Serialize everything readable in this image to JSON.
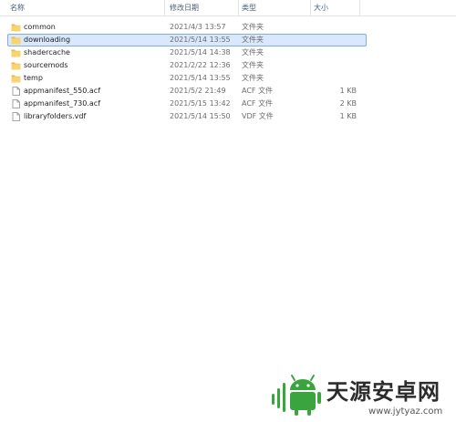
{
  "columns": {
    "name": "名称",
    "date": "修改日期",
    "type": "类型",
    "size": "大小"
  },
  "files": [
    {
      "name": "common",
      "date": "2021/4/3 13:57",
      "type": "文件夹",
      "size": "",
      "icon": "folder-icon",
      "selected": false
    },
    {
      "name": "downloading",
      "date": "2021/5/14 13:55",
      "type": "文件夹",
      "size": "",
      "icon": "folder-icon",
      "selected": true
    },
    {
      "name": "shadercache",
      "date": "2021/5/14 14:38",
      "type": "文件夹",
      "size": "",
      "icon": "folder-icon",
      "selected": false
    },
    {
      "name": "sourcemods",
      "date": "2021/2/22 12:36",
      "type": "文件夹",
      "size": "",
      "icon": "folder-icon",
      "selected": false
    },
    {
      "name": "temp",
      "date": "2021/5/14 13:55",
      "type": "文件夹",
      "size": "",
      "icon": "folder-icon",
      "selected": false
    },
    {
      "name": "appmanifest_550.acf",
      "date": "2021/5/2 21:49",
      "type": "ACF 文件",
      "size": "1 KB",
      "icon": "file-icon",
      "selected": false
    },
    {
      "name": "appmanifest_730.acf",
      "date": "2021/5/15 13:42",
      "type": "ACF 文件",
      "size": "2 KB",
      "icon": "file-icon",
      "selected": false
    },
    {
      "name": "libraryfolders.vdf",
      "date": "2021/5/14 15:50",
      "type": "VDF 文件",
      "size": "1 KB",
      "icon": "file-icon",
      "selected": false
    }
  ],
  "watermark": {
    "title": "天源安卓网",
    "url": "www.jytyaz.com",
    "icon": "android-logo-icon"
  },
  "colors": {
    "selection_bg": "#d9e8fb",
    "selection_border": "#84acdd",
    "folder": "#f1c75a",
    "watermark_green": "#3aa53f"
  }
}
